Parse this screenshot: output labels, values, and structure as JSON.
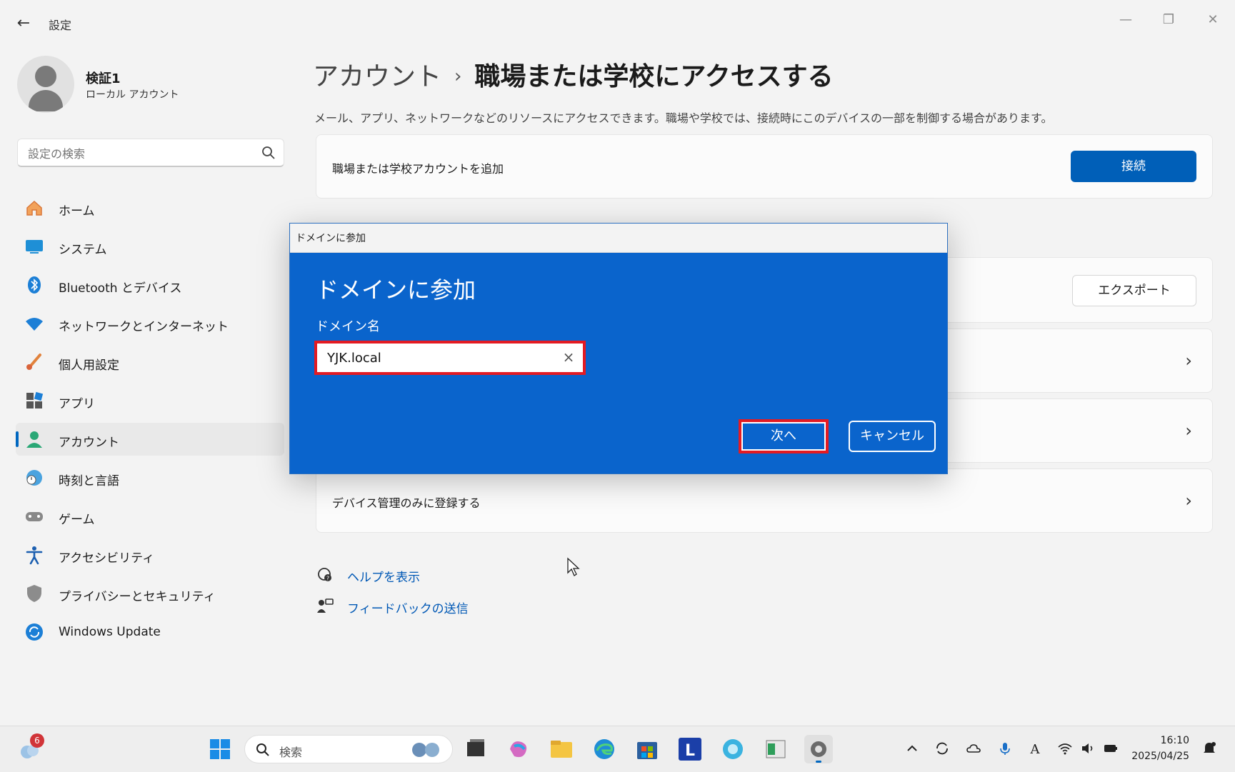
{
  "window": {
    "title": "設定",
    "back_icon": "arrow-left-icon",
    "controls": [
      "minimize-icon",
      "restore-icon",
      "close-icon"
    ]
  },
  "user": {
    "name": "検証1",
    "account_type": "ローカル アカウント"
  },
  "search": {
    "placeholder": "設定の検索"
  },
  "sidebar": {
    "items": [
      {
        "label": "ホーム",
        "icon": "home-icon"
      },
      {
        "label": "システム",
        "icon": "display-icon"
      },
      {
        "label": "Bluetooth とデバイス",
        "icon": "bluetooth-icon"
      },
      {
        "label": "ネットワークとインターネット",
        "icon": "wifi-icon"
      },
      {
        "label": "個人用設定",
        "icon": "brush-icon"
      },
      {
        "label": "アプリ",
        "icon": "apps-icon"
      },
      {
        "label": "アカウント",
        "icon": "account-icon",
        "active": true
      },
      {
        "label": "時刻と言語",
        "icon": "clock-globe-icon"
      },
      {
        "label": "ゲーム",
        "icon": "gamepad-icon"
      },
      {
        "label": "アクセシビリティ",
        "icon": "accessibility-icon"
      },
      {
        "label": "プライバシーとセキュリティ",
        "icon": "shield-icon"
      },
      {
        "label": "Windows Update",
        "icon": "update-icon"
      }
    ]
  },
  "main": {
    "breadcrumb_parent": "アカウント",
    "breadcrumb_separator": "›",
    "breadcrumb_current": "職場または学校にアクセスする",
    "description": "メール、アプリ、ネットワークなどのリソースにアクセスできます。職場や学校では、接続時にこのデバイスの一部を制御する場合があります。",
    "add_account_label": "職場または学校アカウントを追加",
    "connect_label": "接続",
    "export_label": "エクスポート",
    "device_mgmt_label": "デバイス管理のみに登録する",
    "links": {
      "help": "ヘルプを表示",
      "feedback": "フィードバックの送信"
    }
  },
  "dialog": {
    "titlebar": "ドメインに参加",
    "heading": "ドメインに参加",
    "field_label": "ドメイン名",
    "field_value": "YJK.local",
    "next_label": "次へ",
    "cancel_label": "キャンセル",
    "highlight_color": "#e31b23",
    "background_color": "#0a64cc"
  },
  "taskbar": {
    "search_label": "検索",
    "notification_count": "6",
    "time": "16:10",
    "date": "2025/04/25",
    "apps": [
      "windows-start-icon",
      "task-view-icon",
      "copilot-icon",
      "file-explorer-icon",
      "edge-icon",
      "store-icon",
      "l-app-icon",
      "app-circle-icon",
      "terminal-icon",
      "settings-gear-icon"
    ],
    "tray": [
      "chevron-up-icon",
      "sync-icon",
      "cloud-icon",
      "microphone-icon",
      "ime-a-icon",
      "wifi-icon",
      "volume-icon",
      "battery-icon",
      "notification-bell-icon"
    ]
  },
  "colors": {
    "accent": "#005fb8",
    "link": "#0058b5"
  }
}
